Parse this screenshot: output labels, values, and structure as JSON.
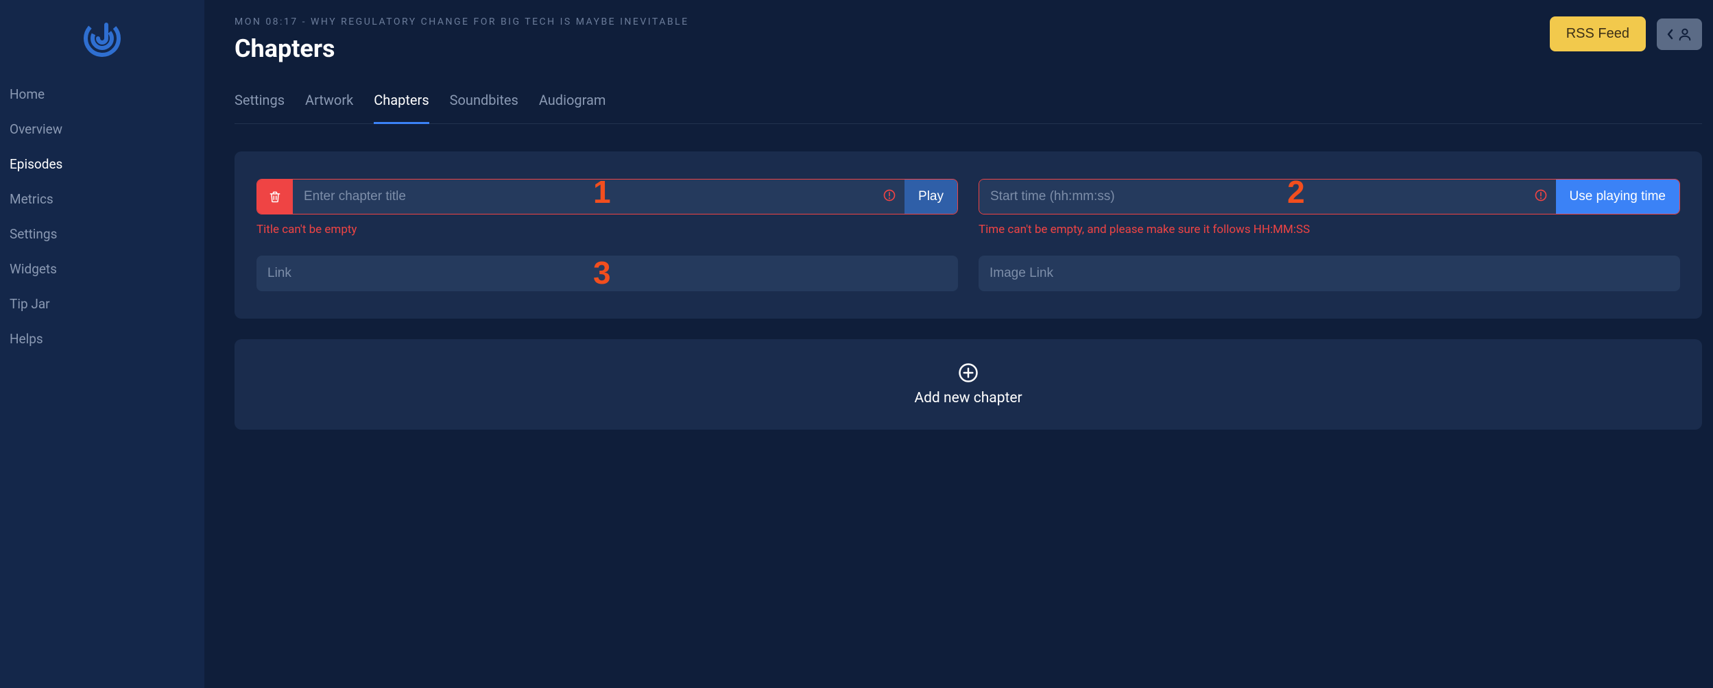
{
  "sidebar": {
    "items": [
      {
        "label": "Home"
      },
      {
        "label": "Overview"
      },
      {
        "label": "Episodes"
      },
      {
        "label": "Metrics"
      },
      {
        "label": "Settings"
      },
      {
        "label": "Widgets"
      },
      {
        "label": "Tip Jar"
      },
      {
        "label": "Helps"
      }
    ],
    "active_index": 2
  },
  "header": {
    "breadcrumb": "MON 08:17 - WHY REGULATORY CHANGE FOR BIG TECH IS MAYBE INEVITABLE",
    "title": "Chapters",
    "rss_label": "RSS Feed"
  },
  "tabs": {
    "items": [
      "Settings",
      "Artwork",
      "Chapters",
      "Soundbites",
      "Audiogram"
    ],
    "active_index": 2
  },
  "chapter": {
    "title_placeholder": "Enter chapter title",
    "title_value": "",
    "title_error": "Title can't be empty",
    "play_label": "Play",
    "time_placeholder": "Start time (hh:mm:ss)",
    "time_value": "",
    "time_error": "Time can't be empty, and please make sure it follows HH:MM:SS",
    "use_time_label": "Use playing time",
    "link_placeholder": "Link",
    "link_value": "",
    "image_link_placeholder": "Image Link",
    "image_link_value": ""
  },
  "add_chapter_label": "Add new chapter",
  "annotations": {
    "a1": "1",
    "a2": "2",
    "a3": "3"
  },
  "colors": {
    "bg": "#0f1e3a",
    "sidebar": "#14274a",
    "card": "#1a2c4d",
    "input": "#253a5d",
    "accent_blue": "#3b82f6",
    "accent_yellow": "#f2c94c",
    "error": "#ef4444"
  }
}
